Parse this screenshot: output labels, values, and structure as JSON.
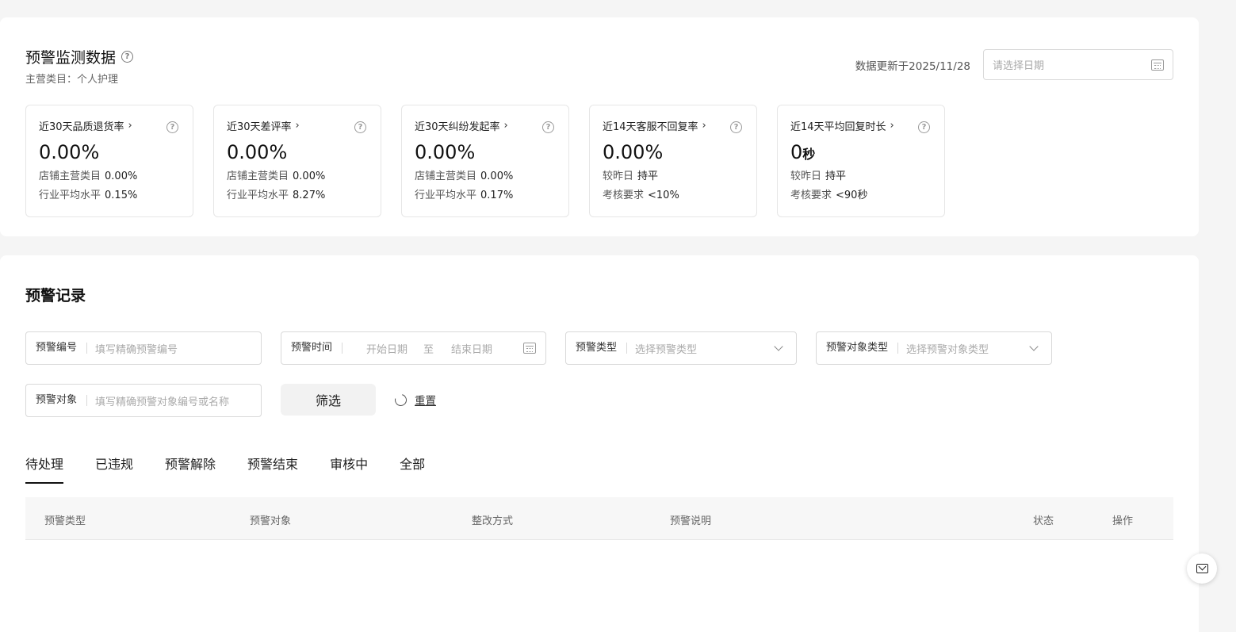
{
  "monitor": {
    "title": "预警监测数据",
    "help_glyph": "?",
    "category": "主营类目：个人护理",
    "update_text": "数据更新于2025/11/28",
    "date_placeholder": "请选择日期",
    "cards": [
      {
        "title": "近30天品质退货率",
        "value": "0.00%",
        "unit": "",
        "line1_label": "店铺主营类目",
        "line1_value": "0.00%",
        "line2_label": "行业平均水平",
        "line2_value": "0.15%"
      },
      {
        "title": "近30天差评率",
        "value": "0.00%",
        "unit": "",
        "line1_label": "店铺主营类目",
        "line1_value": "0.00%",
        "line2_label": "行业平均水平",
        "line2_value": "8.27%"
      },
      {
        "title": "近30天纠纷发起率",
        "value": "0.00%",
        "unit": "",
        "line1_label": "店铺主营类目",
        "line1_value": "0.00%",
        "line2_label": "行业平均水平",
        "line2_value": "0.17%"
      },
      {
        "title": "近14天客服不回复率",
        "value": "0.00%",
        "unit": "",
        "line1_label": "较昨日",
        "line1_value": "持平",
        "line2_label": "考核要求",
        "line2_value": "<10%"
      },
      {
        "title": "近14天平均回复时长",
        "value": "0",
        "unit": "秒",
        "line1_label": "较昨日",
        "line1_value": "持平",
        "line2_label": "考核要求",
        "line2_value": "<90秒"
      }
    ],
    "chevron": "›"
  },
  "records": {
    "title": "预警记录",
    "filters": {
      "id_label": "预警编号",
      "id_placeholder": "填写精确预警编号",
      "time_label": "预警时间",
      "start_placeholder": "开始日期",
      "range_sep": "至",
      "end_placeholder": "结束日期",
      "type_label": "预警类型",
      "type_placeholder": "选择预警类型",
      "object_type_label": "预警对象类型",
      "object_type_placeholder": "选择预警对象类型",
      "object_label": "预警对象",
      "object_placeholder": "填写精确预警对象编号或名称"
    },
    "filter_button": "筛选",
    "reset_link": "重置",
    "tabs": [
      "待处理",
      "已违规",
      "预警解除",
      "预警结束",
      "审核中",
      "全部"
    ],
    "active_tab": 0,
    "columns": [
      "预警类型",
      "预警对象",
      "整改方式",
      "预警说明",
      "状态",
      "操作"
    ]
  }
}
